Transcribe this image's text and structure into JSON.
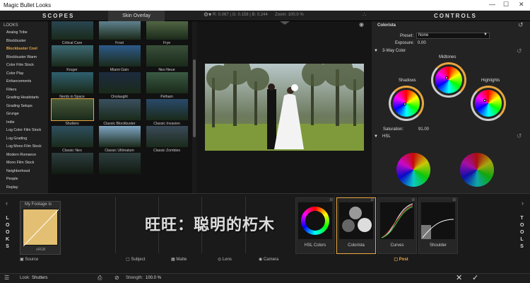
{
  "window": {
    "title": "Magic Bullet Looks"
  },
  "header": {
    "scopes_label": "SCOPES",
    "skin_overlay_label": "Skin Overlay",
    "rgb_readout": "R: 0.067 | G: 0.158 | B: 0.244",
    "zoom_readout": "Zoom: 100.0 %",
    "controls_label": "CONTROLS"
  },
  "looks": {
    "header_label": "LOOKS",
    "items": [
      "Analog Tribe",
      "Blockbuster",
      "Blockbuster Cool",
      "Blockbuster Warm",
      "Color Film Stock",
      "Color Play",
      "Enhancements",
      "Filters",
      "Grading Headstarts",
      "Grading Setups",
      "Grunge",
      "Indie",
      "Log Color Film Stock",
      "Log Grading",
      "Log Mono Film Stock",
      "Modern Romance",
      "Mono Film Stock",
      "Neighborhood",
      "People",
      "Replay"
    ],
    "selected": "Blockbuster Cool"
  },
  "thumbs": [
    "Critical Care",
    "Frost",
    "Frye",
    "Kruger",
    "Miami Gain",
    "Neo Neue",
    "Nerds in Space",
    "Onslaught",
    "Pelham",
    "Shutters",
    "Classic Blockbuster",
    "Classic Invasion",
    "Classic Neo",
    "Classic Ultimatum",
    "Classic Zombies"
  ],
  "thumb_colors": [
    "#2c4a5a",
    "#6a8fa0",
    "#5a6f4a",
    "#3d6a74",
    "#2d5a8a",
    "#3a4f3a",
    "#2f6070",
    "#1d2a40",
    "#3a5a44",
    "#4a5a3a",
    "#3a5060",
    "#2a4a6a",
    "#2f5060",
    "#7fa5c4",
    "#3b4b5a"
  ],
  "controls": {
    "title": "Colorista",
    "preset_label": "Preset:",
    "preset_value": "None",
    "exposure_label": "Exposure:",
    "exposure_value": "0.00",
    "three_way_label": "3-Way Color",
    "midtones": "Midtones",
    "shadows": "Shadows",
    "highlights": "Highlights",
    "saturation_label": "Saturation:",
    "saturation_value": "91.00",
    "hsl_label": "HSL"
  },
  "bottom": {
    "looks_vertical": "LOOKS",
    "tools_vertical": "TOOLS",
    "footage_label": "My Footage Is",
    "footage_value": "sRGB",
    "source_label": "Source",
    "subject_label": "Subject",
    "matte_label": "Matte",
    "lens_label": "Lens",
    "camera_label": "Camera",
    "post_label": "Post",
    "tools": [
      "HSL Colors",
      "Colorista",
      "Curves",
      "Shoulder"
    ],
    "selected_tool": "Colorista"
  },
  "status": {
    "look_label": "Look:",
    "look_value": "Shutters",
    "strength_label": "Strength:",
    "strength_value": "100.0 %"
  },
  "watermark": "旺旺：聪明的朽木",
  "colors": {
    "accent": "#e8a640"
  }
}
